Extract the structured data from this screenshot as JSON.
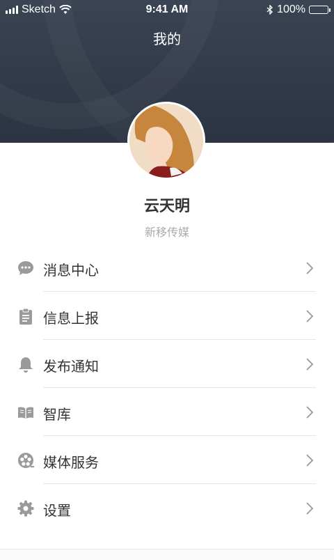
{
  "status_bar": {
    "carrier": "Sketch",
    "time": "9:41 AM",
    "battery": "100%"
  },
  "header": {
    "title": "我的"
  },
  "profile": {
    "name": "云天明",
    "organization": "新移传媒"
  },
  "menu": {
    "items": [
      {
        "label": "消息中心",
        "icon": "message-icon"
      },
      {
        "label": "信息上报",
        "icon": "clipboard-icon"
      },
      {
        "label": "发布通知",
        "icon": "bell-icon"
      },
      {
        "label": "智库",
        "icon": "book-icon"
      },
      {
        "label": "媒体服务",
        "icon": "film-reel-icon"
      },
      {
        "label": "设置",
        "icon": "gear-icon"
      }
    ]
  },
  "colors": {
    "header_bg": "#333b4a",
    "icon_gray": "#9a9a9a",
    "text": "#333333",
    "subtext": "#aaaaaa"
  }
}
